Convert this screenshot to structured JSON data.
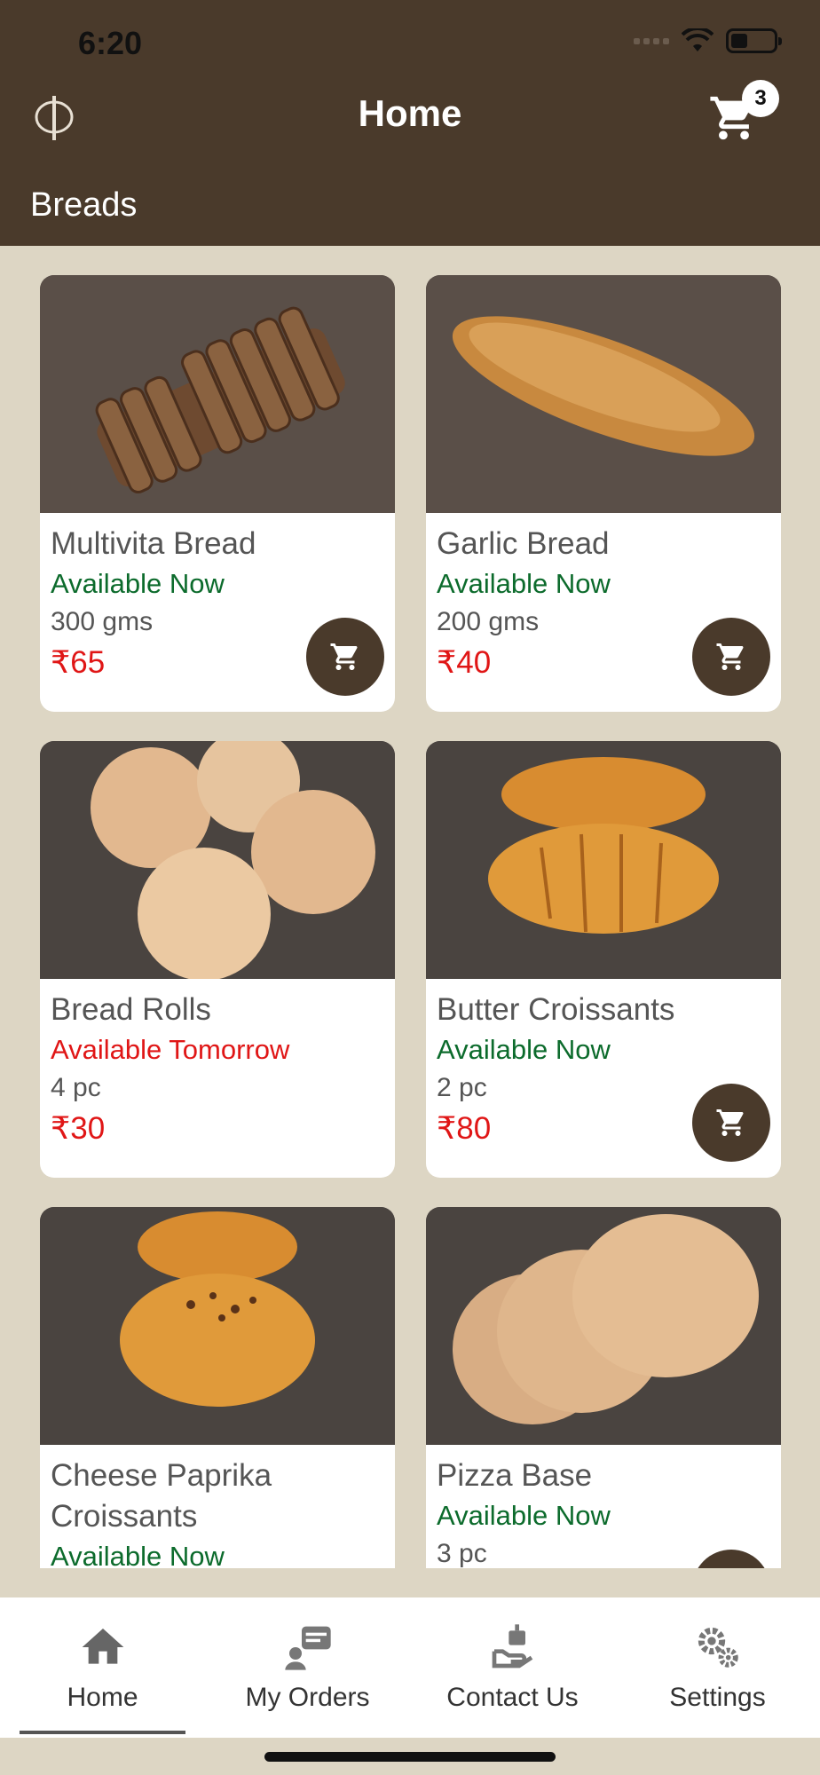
{
  "status_bar": {
    "time": "6:20"
  },
  "header": {
    "title": "Home",
    "cart_count": "3",
    "section": "Breads"
  },
  "products": [
    {
      "name": "Multivita Bread",
      "availability": "Available Now",
      "quantity": "300 gms",
      "price": "₹65",
      "icon": "sliced-bread"
    },
    {
      "name": "Garlic Bread",
      "availability": "Available Now",
      "quantity": "200 gms",
      "price": "₹40",
      "icon": "baguette"
    },
    {
      "name": "Bread Rolls",
      "availability": "Available Tomorrow",
      "quantity": "4 pc",
      "price": "₹30",
      "icon": "rolls"
    },
    {
      "name": "Butter Croissants",
      "availability": "Available Now",
      "quantity": "2 pc",
      "price": "₹80",
      "icon": "croissant"
    },
    {
      "name": "Cheese Paprika Croissants",
      "availability": "Available Now",
      "quantity": "",
      "price": "",
      "icon": "croissant"
    },
    {
      "name": "Pizza Base",
      "availability": "Available Now",
      "quantity": "3 pc",
      "price": "",
      "icon": "pizza-base"
    }
  ],
  "nav": [
    {
      "label": "Home",
      "icon": "home-icon"
    },
    {
      "label": "My Orders",
      "icon": "orders-icon"
    },
    {
      "label": "Contact Us",
      "icon": "contact-icon"
    },
    {
      "label": "Settings",
      "icon": "settings-icon"
    }
  ],
  "colors": {
    "brand": "#4a3a2b",
    "background": "#ddd6c4",
    "available": "#0c6b2c",
    "unavailable": "#e01616",
    "price": "#e01616"
  }
}
